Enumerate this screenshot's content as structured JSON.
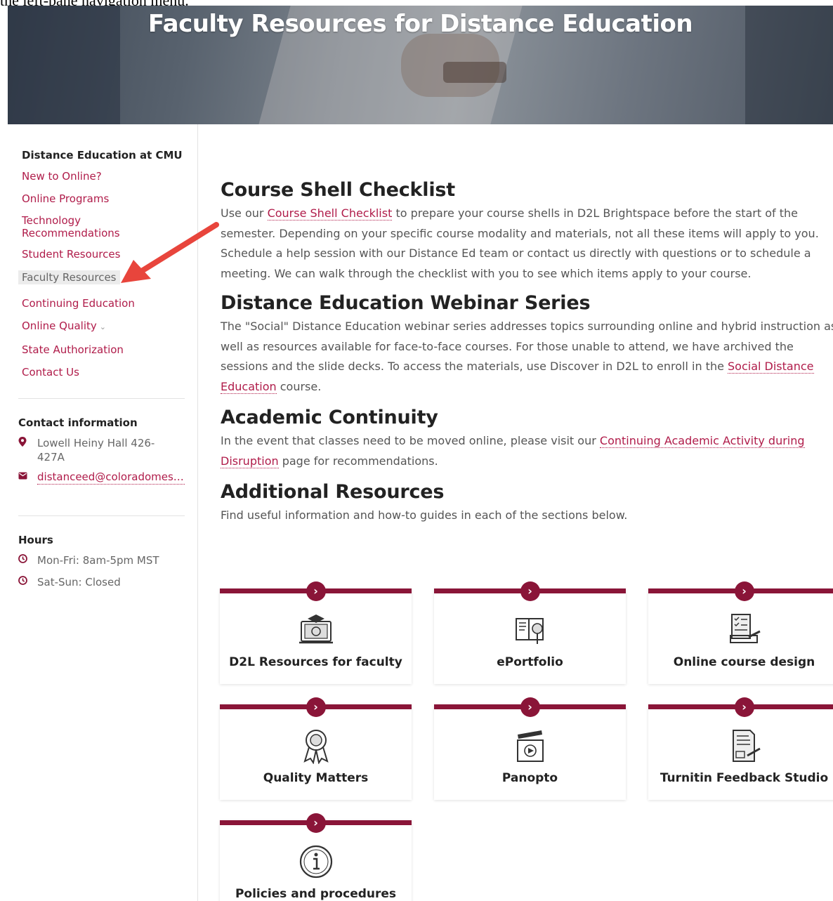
{
  "top_fragment": "the left-pane navigation menu.",
  "hero": {
    "title": "Faculty Resources for Distance Education"
  },
  "sidebar": {
    "heading": "Distance Education at CMU",
    "items": [
      {
        "label": "New to Online?"
      },
      {
        "label": "Online Programs"
      },
      {
        "label": "Technology Recommendations"
      },
      {
        "label": "Student Resources"
      },
      {
        "label": "Faculty Resources",
        "active": true
      },
      {
        "label": "Continuing Education"
      },
      {
        "label": "Online Quality"
      },
      {
        "label": "State Authorization"
      },
      {
        "label": "Contact Us"
      }
    ]
  },
  "contact": {
    "title": "Contact information",
    "address": "Lowell Heiny Hall 426-427A",
    "email": "distanceed@coloradomesa.edu",
    "icons": {
      "address": "map-pin-icon",
      "email": "envelope-icon"
    }
  },
  "hours": {
    "title": "Hours",
    "rows": [
      "Mon-Fri: 8am-5pm MST",
      "Sat-Sun: Closed"
    ],
    "icon": "clock-icon"
  },
  "main": {
    "sections": [
      {
        "title": "Course Shell Checklist",
        "before": "Use our ",
        "link": "Course Shell Checklist",
        "after": " to prepare your course shells in D2L Brightspace before the start of the semester. Depending on your specific course modality and materials, not all these items will apply to you. Schedule a help session with our Distance Ed team or contact us directly with questions or to schedule a meeting. We can walk through the checklist with you to see which items apply to your course."
      },
      {
        "title": "Distance Education Webinar Series",
        "before": "The \"Social\" Distance Education webinar series addresses topics surrounding online and hybrid instruction as well as resources available for face-to-face courses. For those unable to attend, we have archived the sessions and the slide decks. To access the materials, use Discover in D2L to enroll in the ",
        "link": "Social Distance Education",
        "after": " course."
      },
      {
        "title": "Academic Continuity",
        "before": "In the event that classes need to be moved online, please visit our ",
        "link": "Continuing Academic Activity during Disruption",
        "after": " page for recommendations."
      },
      {
        "title": "Additional Resources",
        "before": "Find useful information and how-to guides in each of the sections below.",
        "link": "",
        "after": ""
      }
    ]
  },
  "cards": [
    {
      "label": "D2L Resources for faculty",
      "icon": "graduation-screen-icon"
    },
    {
      "label": "ePortfolio",
      "icon": "portfolio-book-icon"
    },
    {
      "label": "Online course design",
      "icon": "course-design-icon"
    },
    {
      "label": "Quality Matters",
      "icon": "award-ribbon-icon"
    },
    {
      "label": "Panopto",
      "icon": "clapperboard-icon"
    },
    {
      "label": "Turnitin Feedback Studio",
      "icon": "graded-paper-icon"
    },
    {
      "label": "Policies and procedures",
      "icon": "info-circle-icon"
    }
  ],
  "colors": {
    "accent": "#8a1538",
    "link": "#b01c4a",
    "arrow": "#e8453c"
  }
}
